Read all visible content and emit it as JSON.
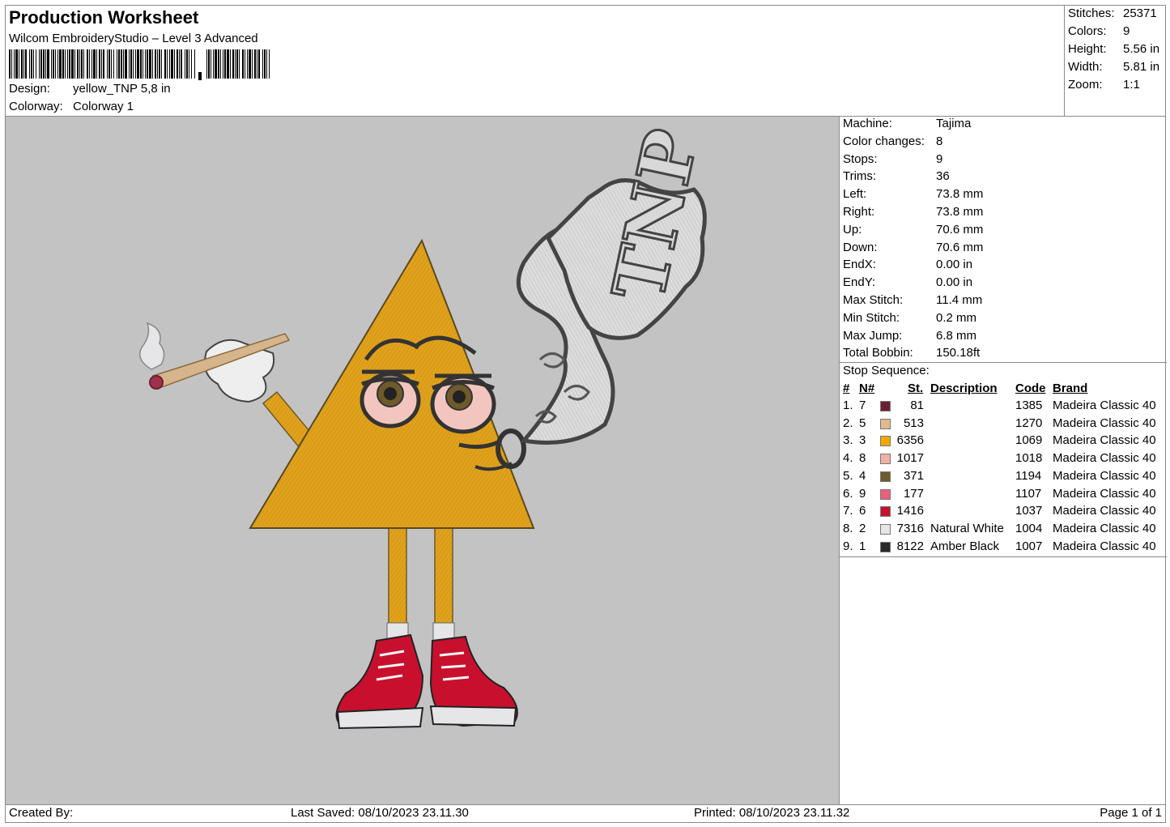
{
  "header": {
    "title": "Production Worksheet",
    "subtitle": "Wilcom EmbroideryStudio – Level 3 Advanced",
    "design_label": "Design:",
    "design_value": "yellow_TNP 5,8 in",
    "colorway_label": "Colorway:",
    "colorway_value": "Colorway 1"
  },
  "summary": [
    {
      "label": "Stitches:",
      "value": "25371"
    },
    {
      "label": "Colors:",
      "value": "9"
    },
    {
      "label": "Height:",
      "value": "5.56 in"
    },
    {
      "label": "Width:",
      "value": "5.81 in"
    },
    {
      "label": "Zoom:",
      "value": "1:1"
    }
  ],
  "machine_info": [
    {
      "label": "Machine:",
      "value": "Tajima"
    },
    {
      "label": "Color changes:",
      "value": "8"
    },
    {
      "label": "Stops:",
      "value": "9"
    },
    {
      "label": "Trims:",
      "value": "36"
    },
    {
      "label": "Left:",
      "value": "73.8 mm"
    },
    {
      "label": "Right:",
      "value": "73.8 mm"
    },
    {
      "label": "Up:",
      "value": "70.6 mm"
    },
    {
      "label": "Down:",
      "value": "70.6 mm"
    },
    {
      "label": "EndX:",
      "value": "0.00 in"
    },
    {
      "label": "EndY:",
      "value": "0.00 in"
    },
    {
      "label": "Max Stitch:",
      "value": "11.4 mm"
    },
    {
      "label": "Min Stitch:",
      "value": "0.2 mm"
    },
    {
      "label": "Max Jump:",
      "value": "6.8 mm"
    },
    {
      "label": "Total Bobbin:",
      "value": "150.18ft"
    }
  ],
  "stop_sequence": {
    "title": "Stop Sequence:",
    "headers": {
      "num": "#",
      "n": "N#",
      "st": "St.",
      "description": "Description",
      "code": "Code",
      "brand": "Brand"
    },
    "rows": [
      {
        "num": "1.",
        "n": "7",
        "color": "#6b1f33",
        "st": "81",
        "description": "",
        "code": "1385",
        "brand": "Madeira Classic 40"
      },
      {
        "num": "2.",
        "n": "5",
        "color": "#e2b98a",
        "st": "513",
        "description": "",
        "code": "1270",
        "brand": "Madeira Classic 40"
      },
      {
        "num": "3.",
        "n": "3",
        "color": "#f0a800",
        "st": "6356",
        "description": "",
        "code": "1069",
        "brand": "Madeira Classic 40"
      },
      {
        "num": "4.",
        "n": "8",
        "color": "#f2b0a4",
        "st": "1017",
        "description": "",
        "code": "1018",
        "brand": "Madeira Classic 40"
      },
      {
        "num": "5.",
        "n": "4",
        "color": "#6e5a2a",
        "st": "371",
        "description": "",
        "code": "1194",
        "brand": "Madeira Classic 40"
      },
      {
        "num": "6.",
        "n": "9",
        "color": "#e8627a",
        "st": "177",
        "description": "",
        "code": "1107",
        "brand": "Madeira Classic 40"
      },
      {
        "num": "7.",
        "n": "6",
        "color": "#c8102e",
        "st": "1416",
        "description": "",
        "code": "1037",
        "brand": "Madeira Classic 40"
      },
      {
        "num": "8.",
        "n": "2",
        "color": "#e6e6e8",
        "st": "7316",
        "description": "Natural White",
        "code": "1004",
        "brand": "Madeira Classic 40"
      },
      {
        "num": "9.",
        "n": "1",
        "color": "#2a2a2a",
        "st": "8122",
        "description": "Amber Black",
        "code": "1007",
        "brand": "Madeira Classic 40"
      }
    ]
  },
  "footer": {
    "created_by": "Created By:",
    "last_saved": "Last Saved: 08/10/2023 23.11.30",
    "printed": "Printed: 08/10/2023 23.11.32",
    "page": "Page 1 of 1"
  },
  "preview": {
    "background": "#c3c3c3",
    "logo_text": "TNP"
  }
}
